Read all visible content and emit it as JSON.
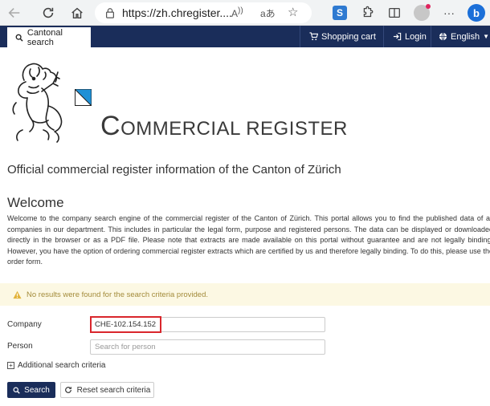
{
  "browser": {
    "url": "https://zh.chregister....",
    "read_aloud_icon": "read-aloud-icon",
    "translate_icon": "translate-icon",
    "extension_label": "S"
  },
  "nav": {
    "cantonal_search": "Cantonal search",
    "shopping_cart": "Shopping cart",
    "login": "Login",
    "language": "English"
  },
  "header": {
    "brand_first": "C",
    "brand_rest": "OMMERCIAL REGISTER",
    "subtitle": "Official commercial register information of the Canton of Zürich"
  },
  "welcome": {
    "title": "Welcome",
    "text": "Welcome to the company search engine of the commercial register of the Canton of Zürich. This portal allows you to find the published data of all companies in our department. This includes in particular the legal form, purpose and registered persons. The data can be displayed or downloaded directly in the browser or as a PDF file. Please note that extracts are made available on this portal without guarantee and are not legally binding. However, you have the option of ordering commercial register extracts which are certified by us and therefore legally binding. To do this, please use the order form."
  },
  "alert": {
    "message": "No results were found for the search criteria provided."
  },
  "form": {
    "company_label": "Company",
    "company_value": "CHE-102.154.152",
    "person_label": "Person",
    "person_placeholder": "Search for person",
    "additional": "Additional search criteria",
    "search_button": "Search",
    "reset_button": "Reset search criteria"
  },
  "colors": {
    "nav_bg": "#1a2d5a",
    "alert_bg": "#fcf8e3",
    "alert_text": "#a38b3a",
    "highlight": "#d9262c"
  }
}
